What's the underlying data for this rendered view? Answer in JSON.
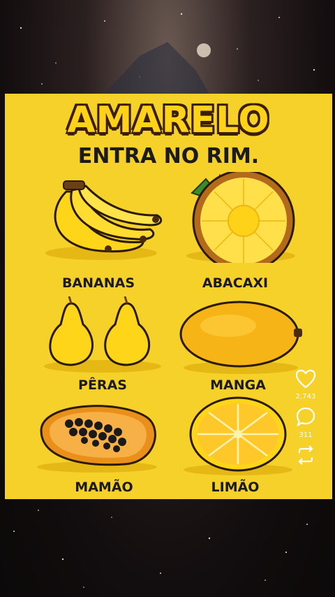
{
  "card": {
    "title": "AMARELO",
    "subtitle": "ENTRA NO RIM."
  },
  "fruits": [
    {
      "label": "BANANAS",
      "icon": "bananas-icon"
    },
    {
      "label": "ABACAXI",
      "icon": "pineapple-icon"
    },
    {
      "label": "PÊRAS",
      "icon": "pears-icon"
    },
    {
      "label": "MANGA",
      "icon": "mango-icon"
    },
    {
      "label": "MAMÃO",
      "icon": "papaya-icon"
    },
    {
      "label": "LIMÃO",
      "icon": "lemon-icon"
    }
  ],
  "actions": {
    "likes": "2,743",
    "comments": "311"
  },
  "colors": {
    "card_background": "#f6d12a",
    "title_fill": "#ffd21a",
    "title_outline": "#3a1e06"
  }
}
